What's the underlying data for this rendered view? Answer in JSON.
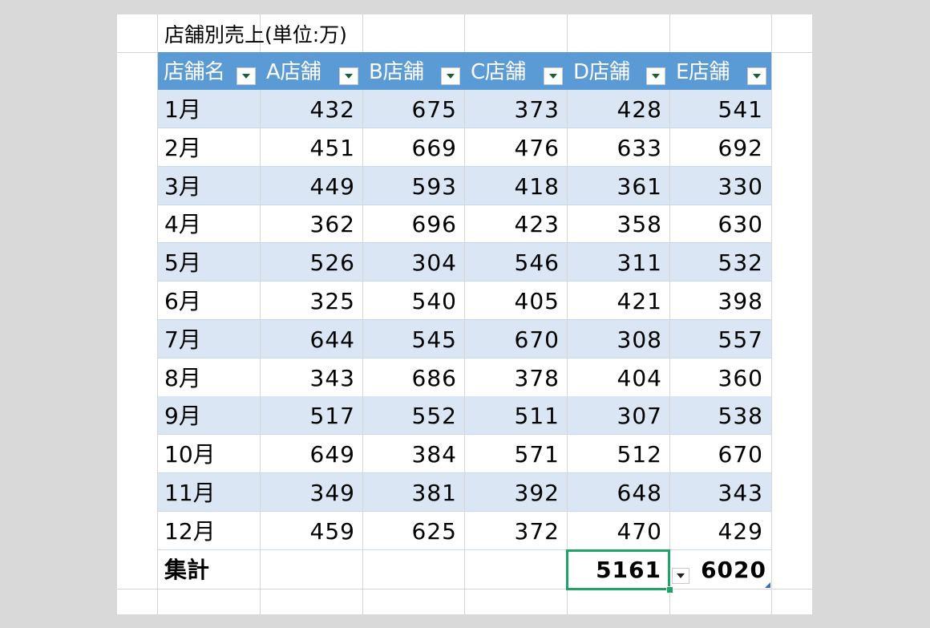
{
  "title": "店舗別売上(単位:万)",
  "header": [
    "店舗名",
    "A店舗",
    "B店舗",
    "C店舗",
    "D店舗",
    "E店舗"
  ],
  "rows": [
    {
      "month": "1月",
      "values": [
        "432",
        "675",
        "373",
        "428",
        "541"
      ]
    },
    {
      "month": "2月",
      "values": [
        "451",
        "669",
        "476",
        "633",
        "692"
      ]
    },
    {
      "month": "3月",
      "values": [
        "449",
        "593",
        "418",
        "361",
        "330"
      ]
    },
    {
      "month": "4月",
      "values": [
        "362",
        "696",
        "423",
        "358",
        "630"
      ]
    },
    {
      "month": "5月",
      "values": [
        "526",
        "304",
        "546",
        "311",
        "532"
      ]
    },
    {
      "month": "6月",
      "values": [
        "325",
        "540",
        "405",
        "421",
        "398"
      ]
    },
    {
      "month": "7月",
      "values": [
        "644",
        "545",
        "670",
        "308",
        "557"
      ]
    },
    {
      "month": "8月",
      "values": [
        "343",
        "686",
        "378",
        "404",
        "360"
      ]
    },
    {
      "month": "9月",
      "values": [
        "517",
        "552",
        "511",
        "307",
        "538"
      ]
    },
    {
      "month": "10月",
      "values": [
        "649",
        "384",
        "571",
        "512",
        "670"
      ]
    },
    {
      "month": "11月",
      "values": [
        "349",
        "381",
        "392",
        "648",
        "343"
      ]
    },
    {
      "month": "12月",
      "values": [
        "459",
        "625",
        "372",
        "470",
        "429"
      ]
    }
  ],
  "total": {
    "label": "集計",
    "values": [
      "",
      "",
      "",
      "5161",
      "6020"
    ]
  },
  "colors": {
    "header_bg": "#5b9bd5",
    "band_bg": "#dbe6f4",
    "selection": "#21a366",
    "filter_arrow": "#1a5d3a"
  },
  "icons": {
    "filter": "filter-dropdown-icon"
  }
}
